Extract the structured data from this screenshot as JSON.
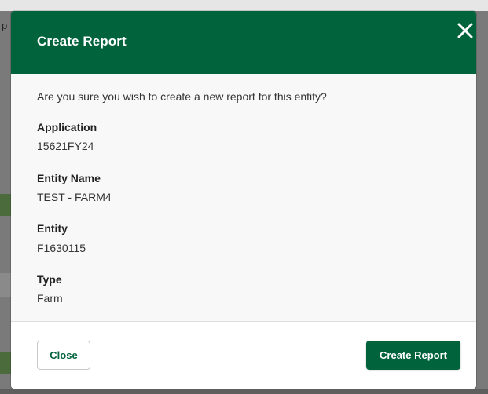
{
  "backdrop": {
    "partial_letter": "p"
  },
  "modal": {
    "title": "Create Report",
    "close_icon": "close-icon",
    "question": "Are you sure you wish to create a new report for this entity?",
    "fields": [
      {
        "label": "Application",
        "value": "15621FY24"
      },
      {
        "label": "Entity Name",
        "value": "TEST - FARM4"
      },
      {
        "label": "Entity",
        "value": "F1630115"
      },
      {
        "label": "Type",
        "value": "Farm"
      }
    ],
    "footer": {
      "close_label": "Close",
      "create_label": "Create Report"
    }
  },
  "colors": {
    "brand_green": "#00633c",
    "body_bg": "#f8f8f8",
    "footer_bg": "#ffffff"
  }
}
